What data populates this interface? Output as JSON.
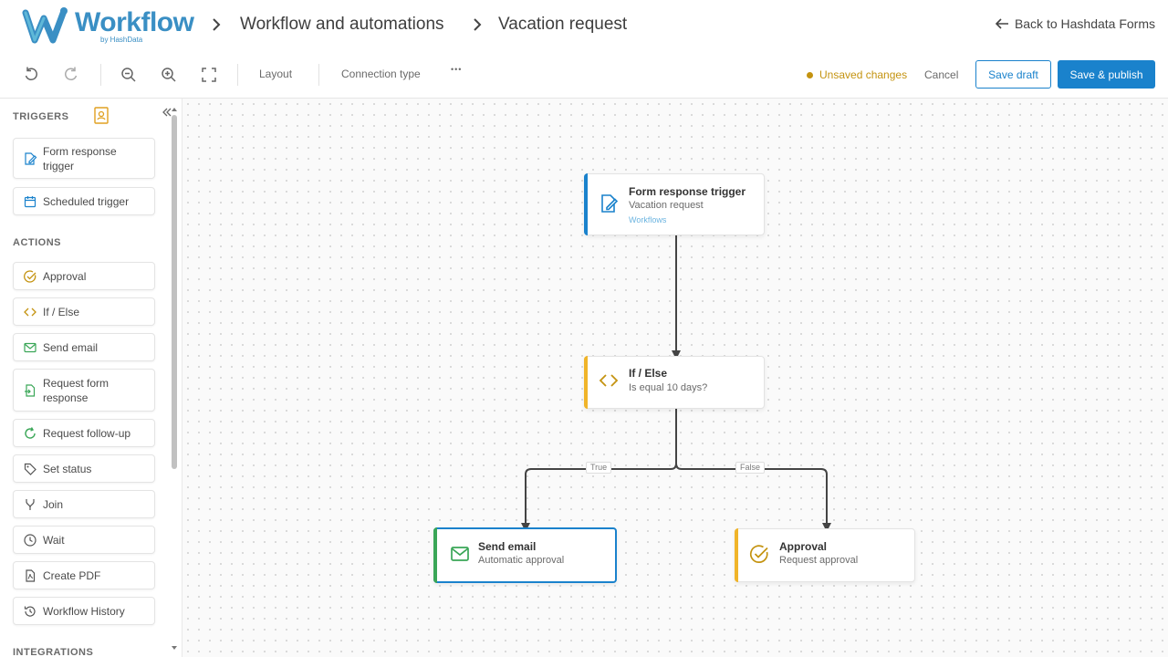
{
  "header": {
    "logo_text": "Workflow",
    "logo_sub": "by HashData",
    "breadcrumb": [
      "Workflow and automations",
      "Vacation request"
    ],
    "back_label": "Back to Hashdata Forms"
  },
  "toolbar": {
    "layout_label": "Layout",
    "connection_type_label": "Connection type",
    "more_label": "•••",
    "unsaved_label": "Unsaved changes",
    "cancel_label": "Cancel",
    "save_draft_label": "Save draft",
    "save_publish_label": "Save & publish",
    "accent_color": "#1a82cc",
    "warning_color": "#c49310"
  },
  "sidebar": {
    "triggers_title": "TRIGGERS",
    "triggers": [
      {
        "label": "Form response trigger",
        "icon": "form-edit-icon"
      },
      {
        "label": "Scheduled trigger",
        "icon": "calendar-icon"
      }
    ],
    "actions_title": "ACTIONS",
    "actions": [
      {
        "label": "Approval",
        "icon": "check-circle-icon"
      },
      {
        "label": "If / Else",
        "icon": "code-brackets-icon"
      },
      {
        "label": "Send email",
        "icon": "mail-icon"
      },
      {
        "label": "Request form response",
        "icon": "document-arrow-icon"
      },
      {
        "label": "Request follow-up",
        "icon": "refresh-icon"
      },
      {
        "label": "Set status",
        "icon": "tag-icon"
      },
      {
        "label": "Join",
        "icon": "merge-icon"
      },
      {
        "label": "Wait",
        "icon": "clock-icon"
      },
      {
        "label": "Create PDF",
        "icon": "pdf-icon"
      },
      {
        "label": "Workflow History",
        "icon": "history-icon"
      }
    ],
    "integrations_title": "INTEGRATIONS"
  },
  "canvas": {
    "nodes": {
      "trigger": {
        "title": "Form response trigger",
        "subtitle": "Vacation request",
        "link": "Workflows",
        "color": "#1a82cc"
      },
      "ifelse": {
        "title": "If / Else",
        "subtitle": "Is equal 10 days?",
        "color": "#f0b429"
      },
      "email": {
        "title": "Send email",
        "subtitle": "Automatic approval",
        "color": "#3aa657"
      },
      "approval": {
        "title": "Approval",
        "subtitle": "Request approval",
        "color": "#f0b429"
      }
    },
    "edge_labels": {
      "true": "True",
      "false": "False"
    }
  }
}
